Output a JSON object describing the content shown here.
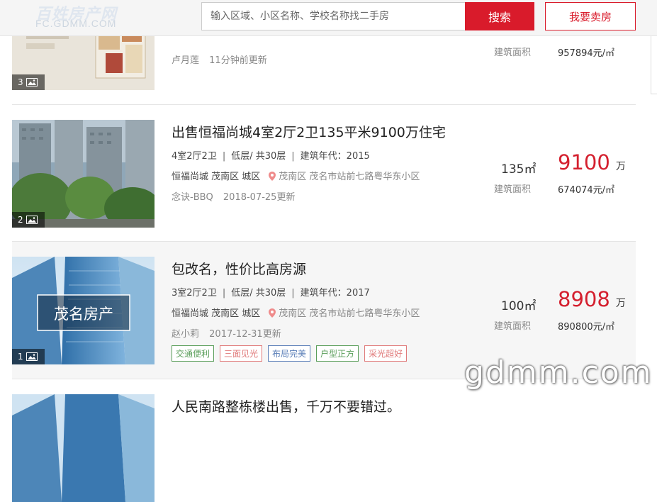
{
  "header": {
    "logo_text": "百姓房产网",
    "logo_sub": "FC.GDMM.COM",
    "search_placeholder": "输入区域、小区名称、学校名称找二手房",
    "search_button": "搜索",
    "sell_button": "我要卖房"
  },
  "listings": [
    {
      "title": "",
      "photo_count": "3",
      "agent": "卢月莲",
      "updated": "11分钟前更新",
      "area_label": "建筑面积",
      "unit_price": "957894元/㎡"
    },
    {
      "title": "出售恒福尚城4室2厅2卫135平米9100万住宅",
      "photo_count": "2",
      "layout": "4室2厅2卫",
      "floor": "低层/ 共30层",
      "year": "建筑年代：2015",
      "community": "恒福尚城 茂南区 城区",
      "address": "茂南区 茂名市站前七路粤华东小区",
      "agent": "念诀-BBQ",
      "updated": "2018-07-25更新",
      "area": "135㎡",
      "area_label": "建筑面积",
      "price": "9100",
      "price_unit": "万",
      "unit_price": "674074元/㎡"
    },
    {
      "title": "包改名，性价比高房源",
      "photo_count": "1",
      "photo_caption": "茂名房产",
      "layout": "3室2厅2卫",
      "floor": "低层/ 共30层",
      "year": "建筑年代：2017",
      "community": "恒福尚城 茂南区 城区",
      "address": "茂南区 茂名市站前七路粤华东小区",
      "agent": "赵小莉",
      "updated": "2017-12-31更新",
      "area": "100㎡",
      "area_label": "建筑面积",
      "price": "8908",
      "price_unit": "万",
      "unit_price": "890800元/㎡",
      "tags": [
        {
          "label": "交通便利",
          "color": "#5a9e5a"
        },
        {
          "label": "三面见光",
          "color": "#e07a7a"
        },
        {
          "label": "布局完美",
          "color": "#5b7fb8"
        },
        {
          "label": "户型正方",
          "color": "#5a9e5a"
        },
        {
          "label": "采光超好",
          "color": "#e07a7a"
        }
      ]
    },
    {
      "title": "人民南路整栋楼出售，千万不要错过。"
    }
  ],
  "watermark": "gdmm.com",
  "colors": {
    "accent": "#d91b2b",
    "price": "#d4202f",
    "highlight_row": "#f6f6f6"
  }
}
